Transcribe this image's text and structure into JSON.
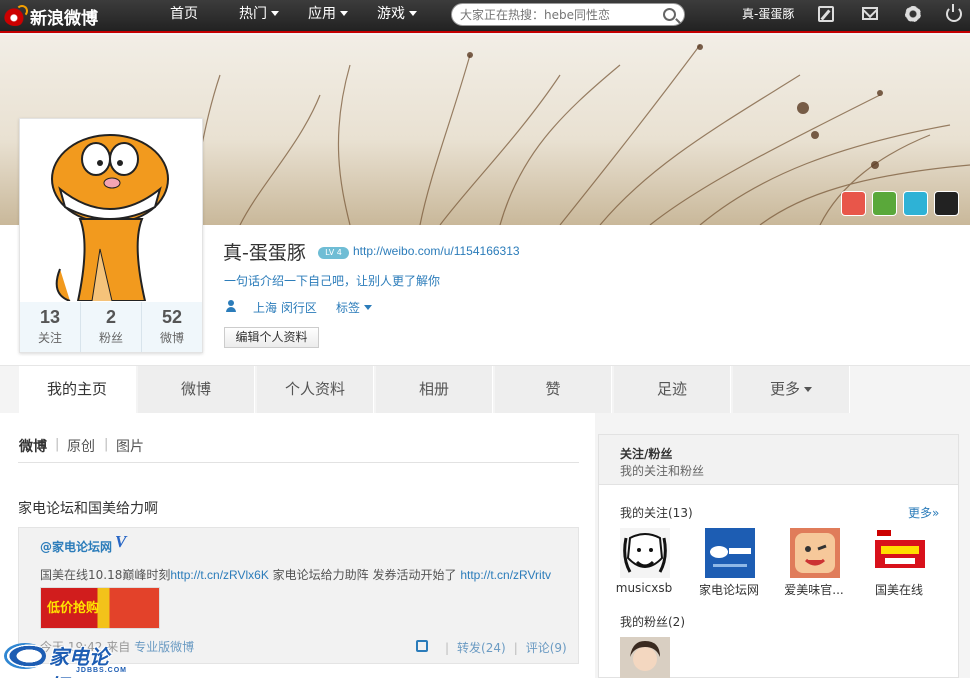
{
  "topnav": {
    "logo": "新浪微博",
    "links": [
      {
        "label": "首页",
        "dropdown": false
      },
      {
        "label": "热门",
        "dropdown": true
      },
      {
        "label": "应用",
        "dropdown": true
      },
      {
        "label": "游戏",
        "dropdown": true
      }
    ],
    "search_placeholder": "大家正在热搜：hebe同性恋",
    "username": "真-蛋蛋豚",
    "icons": [
      "edit-icon",
      "mail-icon",
      "gear-icon",
      "power-icon"
    ]
  },
  "cover": {
    "badges": [
      {
        "icon": "download-badge-icon",
        "color": "#e8564a"
      },
      {
        "icon": "android-badge-icon",
        "color": "#5aa83a"
      },
      {
        "icon": "tablet-badge-icon",
        "color": "#2eb2d6"
      },
      {
        "icon": "love-nba-badge-icon",
        "color": "#222222"
      }
    ]
  },
  "profile": {
    "name": "真-蛋蛋豚",
    "level": "LV 4",
    "url": "http://weibo.com/u/1154166313",
    "intro": "一句话介绍一下自己吧，让别人更了解你",
    "location": "上海 闵行区",
    "tag_label": "标签",
    "edit_button": "编辑个人资料",
    "counts": [
      {
        "num": "13",
        "label": "关注"
      },
      {
        "num": "2",
        "label": "粉丝"
      },
      {
        "num": "52",
        "label": "微博"
      }
    ]
  },
  "tabs": [
    {
      "label": "我的主页",
      "active": true,
      "dropdown": false
    },
    {
      "label": "微博",
      "active": false,
      "dropdown": false
    },
    {
      "label": "个人资料",
      "active": false,
      "dropdown": false
    },
    {
      "label": "相册",
      "active": false,
      "dropdown": false
    },
    {
      "label": "赞",
      "active": false,
      "dropdown": false
    },
    {
      "label": "足迹",
      "active": false,
      "dropdown": false
    },
    {
      "label": "更多",
      "active": false,
      "dropdown": true
    }
  ],
  "feed": {
    "filters": [
      {
        "label": "微博",
        "active": true
      },
      {
        "label": "原创",
        "active": false
      },
      {
        "label": "图片",
        "active": false
      }
    ],
    "post_text": "家电论坛和国美给力啊",
    "repost": {
      "user": "@家电论坛网",
      "verified_badge": "V",
      "text_1": "国美在线10.18巅峰时刻",
      "link_1": "http://t.cn/zRVlx6K",
      "text_2": " 家电论坛给力助阵 发券活动开始了",
      "link_2": "http://t.cn/zRVritv",
      "thumb_text": "低价抢购",
      "time": "今天 19:42",
      "from_label": "来自",
      "source": "专业版微博",
      "repost_count": "转发(24)",
      "comment_count": "评论(9)"
    }
  },
  "watermark": {
    "text": "家电论坛",
    "sub": "JDBBS.COM"
  },
  "sidebar": {
    "title": "关注/粉丝",
    "subtitle": "我的关注和粉丝",
    "following_label": "我的关注(13)",
    "more_link": "更多»",
    "following": [
      {
        "name": "musicxsb"
      },
      {
        "name": "家电论坛网"
      },
      {
        "name": "爱美味官..."
      },
      {
        "name": "国美在线"
      }
    ],
    "followers_label": "我的粉丝(2)"
  }
}
